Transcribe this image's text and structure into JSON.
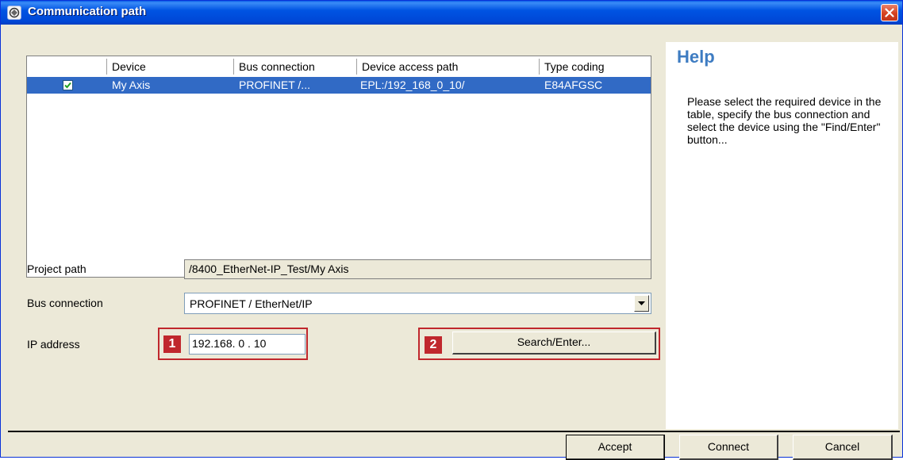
{
  "window": {
    "title": "Communication path"
  },
  "table": {
    "headers": [
      "Device",
      "Bus connection",
      "Device access path",
      "Type coding"
    ],
    "rows": [
      {
        "checked": true,
        "device": "My Axis",
        "bus_connection": "PROFINET /...",
        "access_path": "EPL:/192_168_0_10/",
        "type_coding": "E84AFGSC"
      }
    ]
  },
  "form": {
    "project_path_label": "Project path",
    "project_path_value": "/8400_EtherNet-IP_Test/My Axis",
    "bus_connection_label": "Bus connection",
    "bus_connection_value": "PROFINET / EtherNet/IP",
    "ip_address_label": "IP address",
    "ip_address_value": "192.168.  0  . 10",
    "search_button_label": "Search/Enter...",
    "callout_1": "1",
    "callout_2": "2"
  },
  "help": {
    "title": "Help",
    "text": "Please select the required device in the table, specify the bus connection and select the device using the \"Find/Enter\" button..."
  },
  "buttons": {
    "accept": "Accept",
    "connect": "Connect",
    "cancel": "Cancel"
  },
  "colors": {
    "title_bar": "#0054e3",
    "selection": "#316ac5",
    "callout": "#c0272d",
    "help_title": "#3e7cc2"
  }
}
